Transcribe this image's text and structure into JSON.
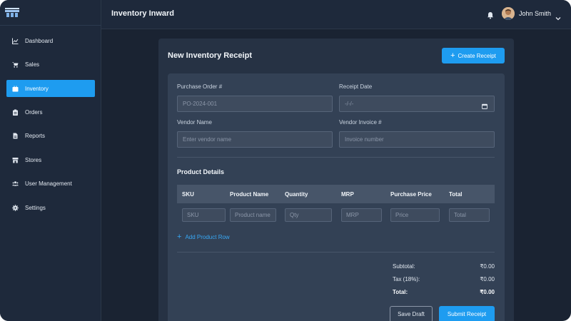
{
  "header": {
    "page_title": "Inventory Inward",
    "user_name": "John Smith"
  },
  "sidebar": {
    "items": [
      {
        "label": "Dashboard",
        "icon": "chart-line-icon",
        "active": false
      },
      {
        "label": "Sales",
        "icon": "cart-icon",
        "active": false
      },
      {
        "label": "Inventory",
        "icon": "box-icon",
        "active": true
      },
      {
        "label": "Orders",
        "icon": "clipboard-icon",
        "active": false
      },
      {
        "label": "Reports",
        "icon": "file-icon",
        "active": false
      },
      {
        "label": "Stores",
        "icon": "store-icon",
        "active": false
      },
      {
        "label": "User Management",
        "icon": "users-icon",
        "active": false
      },
      {
        "label": "Settings",
        "icon": "gear-icon",
        "active": false
      }
    ]
  },
  "receipt": {
    "title": "New Inventory Receipt",
    "create_button": "Create Receipt",
    "fields": {
      "po_label": "Purchase Order #",
      "po_placeholder": "PO-2024-001",
      "date_label": "Receipt Date",
      "date_placeholder": "-/-/-",
      "vendor_label": "Vendor Name",
      "vendor_placeholder": "Enter vendor name",
      "invoice_label": "Vendor Invoice #",
      "invoice_placeholder": "Invoice number"
    },
    "products": {
      "title": "Product Details",
      "columns": [
        "SKU",
        "Product Name",
        "Quantity",
        "MRP",
        "Purchase Price",
        "Total"
      ],
      "placeholders": [
        "SKU",
        "Product name",
        "Qty",
        "MRP",
        "Price",
        "Total"
      ],
      "add_row": "Add Product Row"
    },
    "summary": {
      "subtotal_label": "Subtotal:",
      "subtotal_value": "₹0.00",
      "tax_label": "Tax (18%):",
      "tax_value": "₹0.00",
      "total_label": "Total:",
      "total_value": "₹0.00"
    },
    "save_draft": "Save Draft",
    "submit": "Submit Receipt"
  },
  "colors": {
    "accent": "#1e9cf0",
    "sidebar_bg": "#1e293b",
    "card_bg": "#263244",
    "panel_bg": "#334155"
  }
}
